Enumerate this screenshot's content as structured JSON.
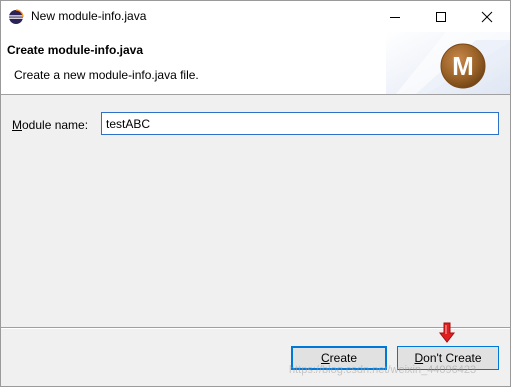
{
  "window": {
    "title": "New module-info.java",
    "icon": "eclipse-icon"
  },
  "banner": {
    "title": "Create module-info.java",
    "description": "Create a new module-info.java file.",
    "graphic_letter": "M"
  },
  "form": {
    "label_prefix": "M",
    "label_rest": "odule name:",
    "module_name_value": "testABC"
  },
  "buttons": {
    "create_prefix": "C",
    "create_rest": "reate",
    "dont_create_prefix": "D",
    "dont_create_rest": "on't Create"
  },
  "watermark": "https://blog.csdn.net/weixin_44096423",
  "colors": {
    "focus_border": "#0078d7",
    "input_border": "#2e72c8",
    "arrow": "#e02020",
    "badge": "#8a5a20"
  }
}
